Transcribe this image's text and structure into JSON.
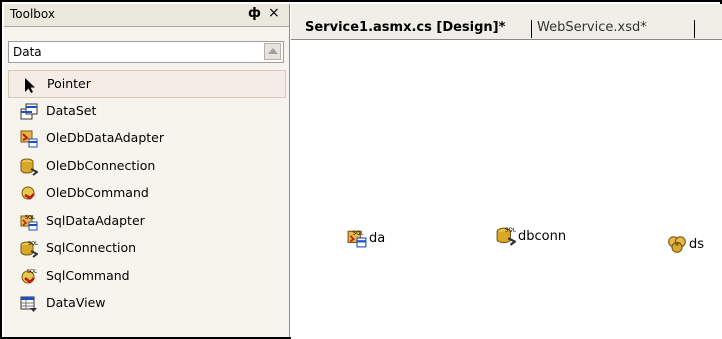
{
  "toolbox": {
    "title": "Toolbox",
    "pin_glyph": "ф",
    "close_glyph": "×",
    "category": "Data",
    "items": [
      {
        "label": "Pointer",
        "icon": "pointer-icon"
      },
      {
        "label": "DataSet",
        "icon": "dataset-icon"
      },
      {
        "label": "OleDbDataAdapter",
        "icon": "oledb-data-adapter-icon"
      },
      {
        "label": "OleDbConnection",
        "icon": "oledb-connection-icon"
      },
      {
        "label": "OleDbCommand",
        "icon": "oledb-command-icon"
      },
      {
        "label": "SqlDataAdapter",
        "icon": "sql-data-adapter-icon"
      },
      {
        "label": "SqlConnection",
        "icon": "sql-connection-icon"
      },
      {
        "label": "SqlCommand",
        "icon": "sql-command-icon"
      },
      {
        "label": "DataView",
        "icon": "dataview-icon"
      }
    ]
  },
  "document_tabs": [
    {
      "label": "Service1.asmx.cs [Design]*",
      "active": true
    },
    {
      "label": "WebService.xsd*",
      "active": false
    }
  ],
  "components": [
    {
      "label": "da",
      "icon": "sql-data-adapter-icon"
    },
    {
      "label": "dbconn",
      "icon": "sql-connection-icon"
    },
    {
      "label": "ds",
      "icon": "dataset-component-icon"
    }
  ]
}
